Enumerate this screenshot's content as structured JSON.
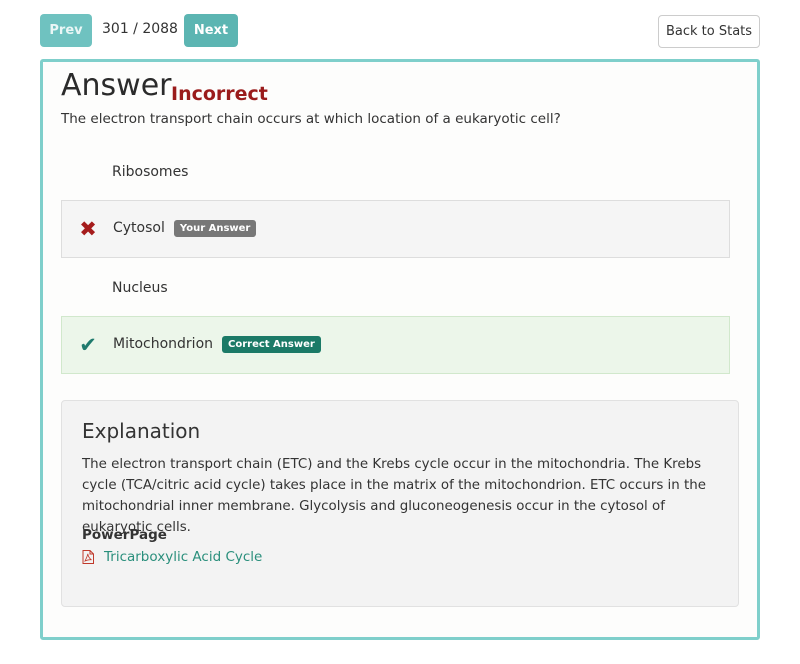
{
  "nav": {
    "prev_label": "Prev",
    "counter": "301 / 2088",
    "next_label": "Next",
    "back_label": "Back to Stats"
  },
  "answer": {
    "heading": "Answer",
    "status": "Incorrect",
    "question": "The electron transport chain occurs at which location of a eukaryotic cell?",
    "options": [
      {
        "label": "Ribosomes",
        "state": "none",
        "badge": ""
      },
      {
        "label": "Cytosol",
        "state": "selected-wrong",
        "badge": "Your Answer"
      },
      {
        "label": "Nucleus",
        "state": "none",
        "badge": ""
      },
      {
        "label": "Mitochondrion",
        "state": "correct",
        "badge": "Correct Answer"
      }
    ]
  },
  "explanation": {
    "title": "Explanation",
    "text": "The electron transport chain (ETC) and the Krebs cycle occur in the mitochondria. The Krebs cycle (TCA/citric acid cycle) takes place in the matrix of the mitochondrion. ETC occurs in the mitochondrial inner membrane. Glycolysis and gluconeogenesis occur in the cytosol of eukaryotic cells.",
    "powerpage_label": "PowerPage",
    "link_text": "Tricarboxylic Acid Cycle"
  },
  "colors": {
    "accent": "#7fcfcb",
    "incorrect": "#9a1b1b",
    "correct": "#1b7a67",
    "link": "#2a8f7c"
  },
  "icons": [
    "x-icon",
    "check-icon",
    "pdf-icon"
  ]
}
